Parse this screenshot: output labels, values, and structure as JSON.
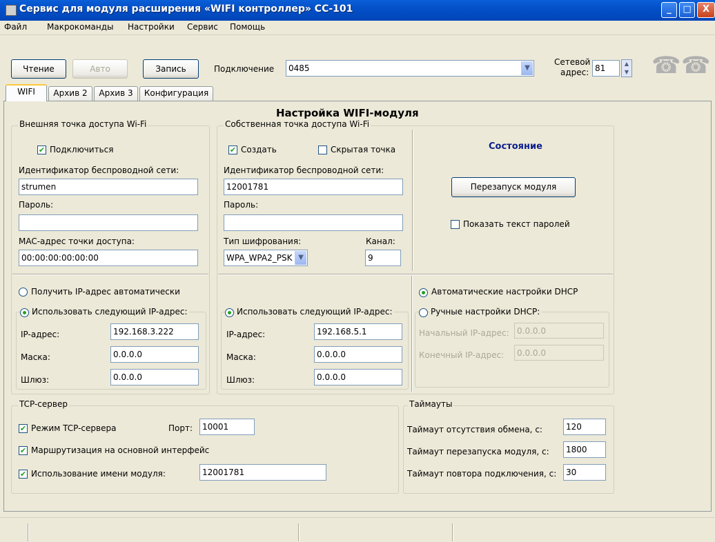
{
  "window": {
    "title": "Сервис для модуля расширения «WIFI контроллер» СС-101",
    "controls": {
      "minimize": "_",
      "maximize": "□",
      "close": "X"
    }
  },
  "menu": [
    "Файл",
    "Макрокоманды",
    "Настройки",
    "Сервис",
    "Помощь"
  ],
  "toolbar": {
    "read": "Чтение",
    "auto": "Авто",
    "write": "Запись",
    "connection_label": "Подключение",
    "connection_value": "0485",
    "net_address_label_1": "Сетевой",
    "net_address_label_2": "адрес:",
    "net_address_value": "81",
    "phone_icons": [
      "phone-icon",
      "phone-icon"
    ]
  },
  "tabs": [
    "WIFI",
    "Архив 2",
    "Архив 3",
    "Конфигурация"
  ],
  "page_title": "Настройка WIFI-модуля",
  "external_ap": {
    "legend": "Внешняя точка доступа Wi-Fi",
    "connect": "Подключиться",
    "ssid_label": "Идентификатор беспроводной сети:",
    "ssid_value": "strumen",
    "password_label": "Пароль:",
    "password_value": "",
    "mac_label": "MAC-адрес точки доступа:",
    "mac_value": "00:00:00:00:00:00",
    "ip_auto": "Получить IP-адрес автоматически",
    "ip_manual": "Использовать следующий IP-адрес:",
    "ip_label": "IP-адрес:",
    "ip_value": "192.168.3.222",
    "mask_label": "Маска:",
    "mask_value": "0.0.0.0",
    "gateway_label": "Шлюз:",
    "gateway_value": "0.0.0.0"
  },
  "own_ap": {
    "legend": "Собственная точка доступа Wi-Fi",
    "create": "Создать",
    "hidden": "Скрытая точка",
    "ssid_label": "Идентификатор беспроводной сети:",
    "ssid_value": "12001781",
    "password_label": "Пароль:",
    "password_value": "",
    "encryption_label": "Тип шифрования:",
    "encryption_value": "WPA_WPA2_PSK",
    "channel_label": "Канал:",
    "channel_value": "9",
    "ip_manual": "Использовать следующий IP-адрес:",
    "ip_label": "IP-адрес:",
    "ip_value": "192.168.5.1",
    "mask_label": "Маска:",
    "mask_value": "0.0.0.0",
    "gateway_label": "Шлюз:",
    "gateway_value": "0.0.0.0"
  },
  "module": {
    "status": "Состояние",
    "restart": "Перезапуск модуля",
    "show_passwords": "Показать текст паролей"
  },
  "dhcp": {
    "auto": "Автоматические настройки DHCP",
    "manual": "Ручные настройки DHCP:",
    "start_label": "Начальный IP-адрес:",
    "start_value": "0.0.0.0",
    "end_label": "Конечный IP-адрес:",
    "end_value": "0.0.0.0"
  },
  "tcp": {
    "legend": "TCP-сервер",
    "server_mode": "Режим TCP-сервера",
    "port_label": "Порт:",
    "port_value": "10001",
    "routing": "Маршрутизация на основной интерфейс",
    "use_name": "Использование имени модуля:",
    "name_value": "12001781"
  },
  "timeouts": {
    "legend": "Таймауты",
    "exchange_label": "Таймаут отсутствия обмена, с:",
    "exchange_value": "120",
    "restart_label": "Таймаут перезапуска модуля, с:",
    "restart_value": "1800",
    "reconnect_label": "Таймаут повтора подключения, с:",
    "reconnect_value": "30"
  }
}
